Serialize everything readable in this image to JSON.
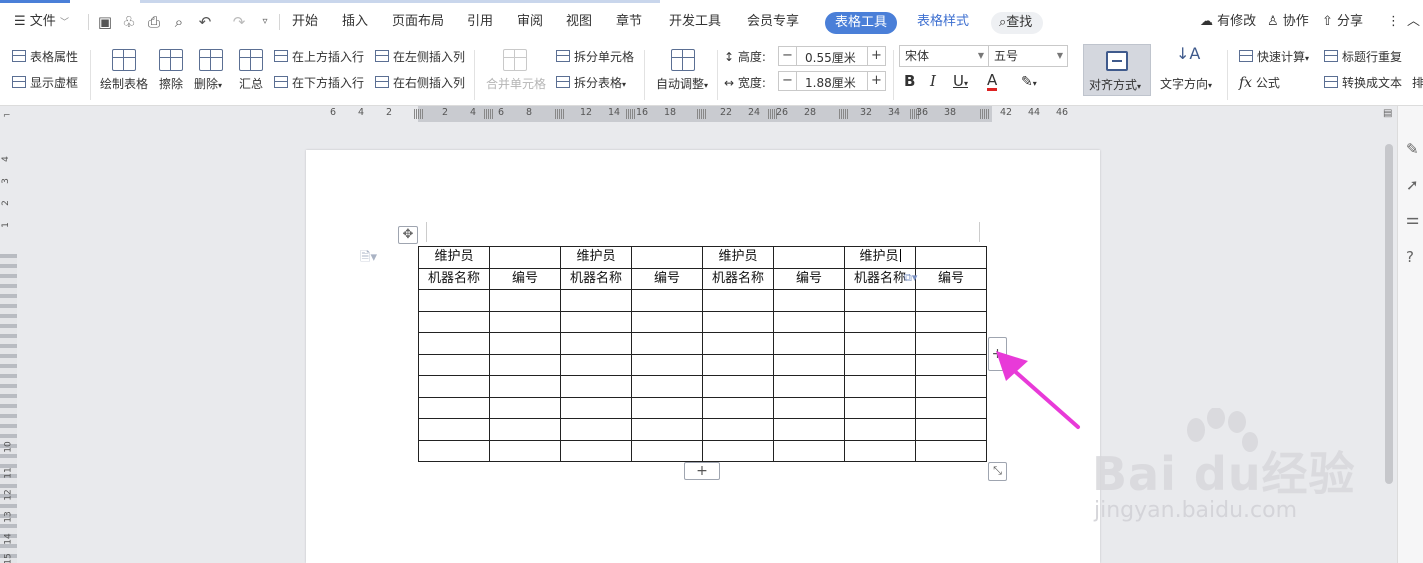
{
  "titlebar": {
    "menu_label": "文件",
    "tabs": [
      {
        "label": "开始"
      },
      {
        "label": "插入"
      },
      {
        "label": "页面布局"
      },
      {
        "label": "引用"
      },
      {
        "label": "审阅"
      },
      {
        "label": "视图"
      },
      {
        "label": "章节"
      },
      {
        "label": "开发工具"
      },
      {
        "label": "会员专享"
      },
      {
        "label": "表格工具"
      },
      {
        "label": "表格样式"
      }
    ],
    "search_label": "查找",
    "modify_label": "有修改",
    "collab_label": "协作",
    "share_label": "分享"
  },
  "ribbon": {
    "table_props": "表格属性",
    "show_gridlines": "显示虚框",
    "draw_table": "绘制表格",
    "erase": "擦除",
    "delete": "删除",
    "summarize": "汇总",
    "insert_above": "在上方插入行",
    "insert_below": "在下方插入行",
    "insert_left": "在左侧插入列",
    "insert_right": "在右侧插入列",
    "merge_cells": "合并单元格",
    "split_cells": "拆分单元格",
    "split_table": "拆分表格",
    "auto_fit": "自动调整",
    "height_label": "高度:",
    "height_value": "0.55厘米",
    "width_label": "宽度:",
    "width_value": "1.88厘米",
    "font_name": "宋体",
    "font_size": "五号",
    "align": "对齐方式",
    "text_direction": "文字方向",
    "quick_calc": "快速计算",
    "fx_formula": "公式",
    "repeat_header": "标题行重复",
    "to_text": "转换成文本",
    "cut_label": "排"
  },
  "ruler": {
    "ticks": [
      "6",
      "4",
      "2",
      "2",
      "4",
      "6",
      "8",
      "12",
      "14",
      "16",
      "18",
      "22",
      "24",
      "26",
      "28",
      "32",
      "34",
      "36",
      "38",
      "42",
      "44",
      "46"
    ],
    "vticks": [
      "4",
      "3",
      "2",
      "1",
      "1",
      "2",
      "3",
      "4",
      "5",
      "6",
      "7",
      "8",
      "9",
      "10",
      "11",
      "12",
      "13",
      "14",
      "15"
    ]
  },
  "table": {
    "rows": [
      [
        "维护员",
        "",
        "维护员",
        "",
        "维护员",
        "",
        "维护员",
        ""
      ],
      [
        "机器名称",
        "编号",
        "机器名称",
        "编号",
        "机器名称",
        "编号",
        "机器名称",
        "编号"
      ],
      [
        "",
        "",
        "",
        "",
        "",
        "",
        "",
        ""
      ],
      [
        "",
        "",
        "",
        "",
        "",
        "",
        "",
        ""
      ],
      [
        "",
        "",
        "",
        "",
        "",
        "",
        "",
        ""
      ],
      [
        "",
        "",
        "",
        "",
        "",
        "",
        "",
        ""
      ],
      [
        "",
        "",
        "",
        "",
        "",
        "",
        "",
        ""
      ],
      [
        "",
        "",
        "",
        "",
        "",
        "",
        "",
        ""
      ],
      [
        "",
        "",
        "",
        "",
        "",
        "",
        "",
        ""
      ],
      [
        "",
        "",
        "",
        "",
        "",
        "",
        "",
        ""
      ]
    ]
  },
  "controls": {
    "add_column": "+",
    "add_row": "+"
  },
  "watermark": {
    "brand": "Bai du经验",
    "url": "jingyan.baidu.com"
  },
  "colors": {
    "accent": "#4a7fd8",
    "arrow": "#e83ad8"
  }
}
